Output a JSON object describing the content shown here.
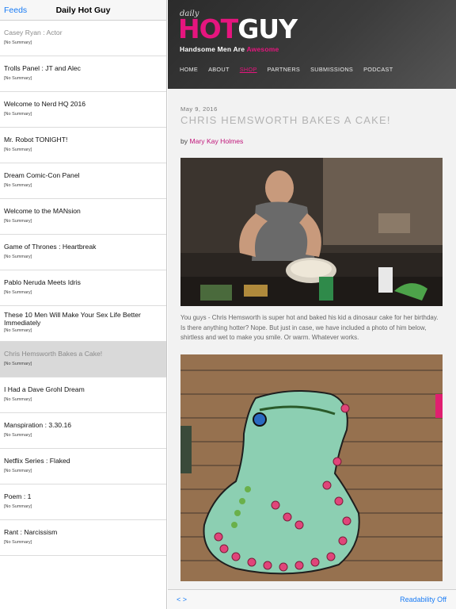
{
  "sidebar": {
    "back_label": "Feeds",
    "title": "Daily Hot Guy",
    "items": [
      {
        "title": "Casey Ryan : Actor",
        "summary": "[No Summary]",
        "state": "read"
      },
      {
        "title": "Trolls Panel : JT and Alec",
        "summary": "[No Summary]",
        "state": "unread"
      },
      {
        "title": "Welcome to Nerd HQ 2016",
        "summary": "[No Summary]",
        "state": "unread"
      },
      {
        "title": "Mr. Robot TONIGHT!",
        "summary": "[No Summary]",
        "state": "unread"
      },
      {
        "title": "Dream Comic-Con Panel",
        "summary": "[No Summary]",
        "state": "unread"
      },
      {
        "title": "Welcome to the MANsion",
        "summary": "[No Summary]",
        "state": "unread"
      },
      {
        "title": "Game of Thrones : Heartbreak",
        "summary": "[No Summary]",
        "state": "unread"
      },
      {
        "title": "Pablo Neruda Meets Idris",
        "summary": "[No Summary]",
        "state": "unread"
      },
      {
        "title": "These 10 Men Will Make Your Sex Life Better Immediately",
        "summary": "[No Summary]",
        "state": "unread"
      },
      {
        "title": "Chris Hemsworth Bakes a Cake!",
        "summary": "[No Summary]",
        "state": "selected"
      },
      {
        "title": "I Had a Dave Grohl Dream",
        "summary": "[No Summary]",
        "state": "unread"
      },
      {
        "title": "Manspiration : 3.30.16",
        "summary": "[No Summary]",
        "state": "unread"
      },
      {
        "title": "Netflix Series : Flaked",
        "summary": "[No Summary]",
        "state": "unread"
      },
      {
        "title": "Poem : 1",
        "summary": "[No Summary]",
        "state": "unread"
      },
      {
        "title": "Rant : Narcissism",
        "summary": "[No Summary]",
        "state": "unread"
      }
    ]
  },
  "site": {
    "logo_daily": "daily",
    "logo_hot": "HOT",
    "logo_guy": "GUY",
    "tagline_prefix": "Handsome Men Are ",
    "tagline_accent": "Awesome",
    "nav": [
      "HOME",
      "ABOUT",
      "SHOP",
      "PARTNERS",
      "SUBMISSIONS",
      "PODCAST"
    ],
    "active_nav": "SHOP",
    "brand_color": "#e6157e"
  },
  "article": {
    "date": "May 9, 2016",
    "title": "CHRIS HEMSWORTH BAKES A CAKE!",
    "byline_prefix": "by ",
    "author": "Mary Kay Holmes",
    "body": "You guys - Chris Hemsworth is super hot and baked his kid a dinosaur cake for her birthday. Is there anything hotter? Nope. But just in case, we have included a photo of him below, shirtless and wet to make you smile. Or warm. Whatever works."
  },
  "bottom_bar": {
    "arrows": "< >",
    "readability_label": "Readability Off"
  },
  "icons": {
    "photo1": "man-baking-photo",
    "photo2": "dinosaur-cake-photo"
  }
}
